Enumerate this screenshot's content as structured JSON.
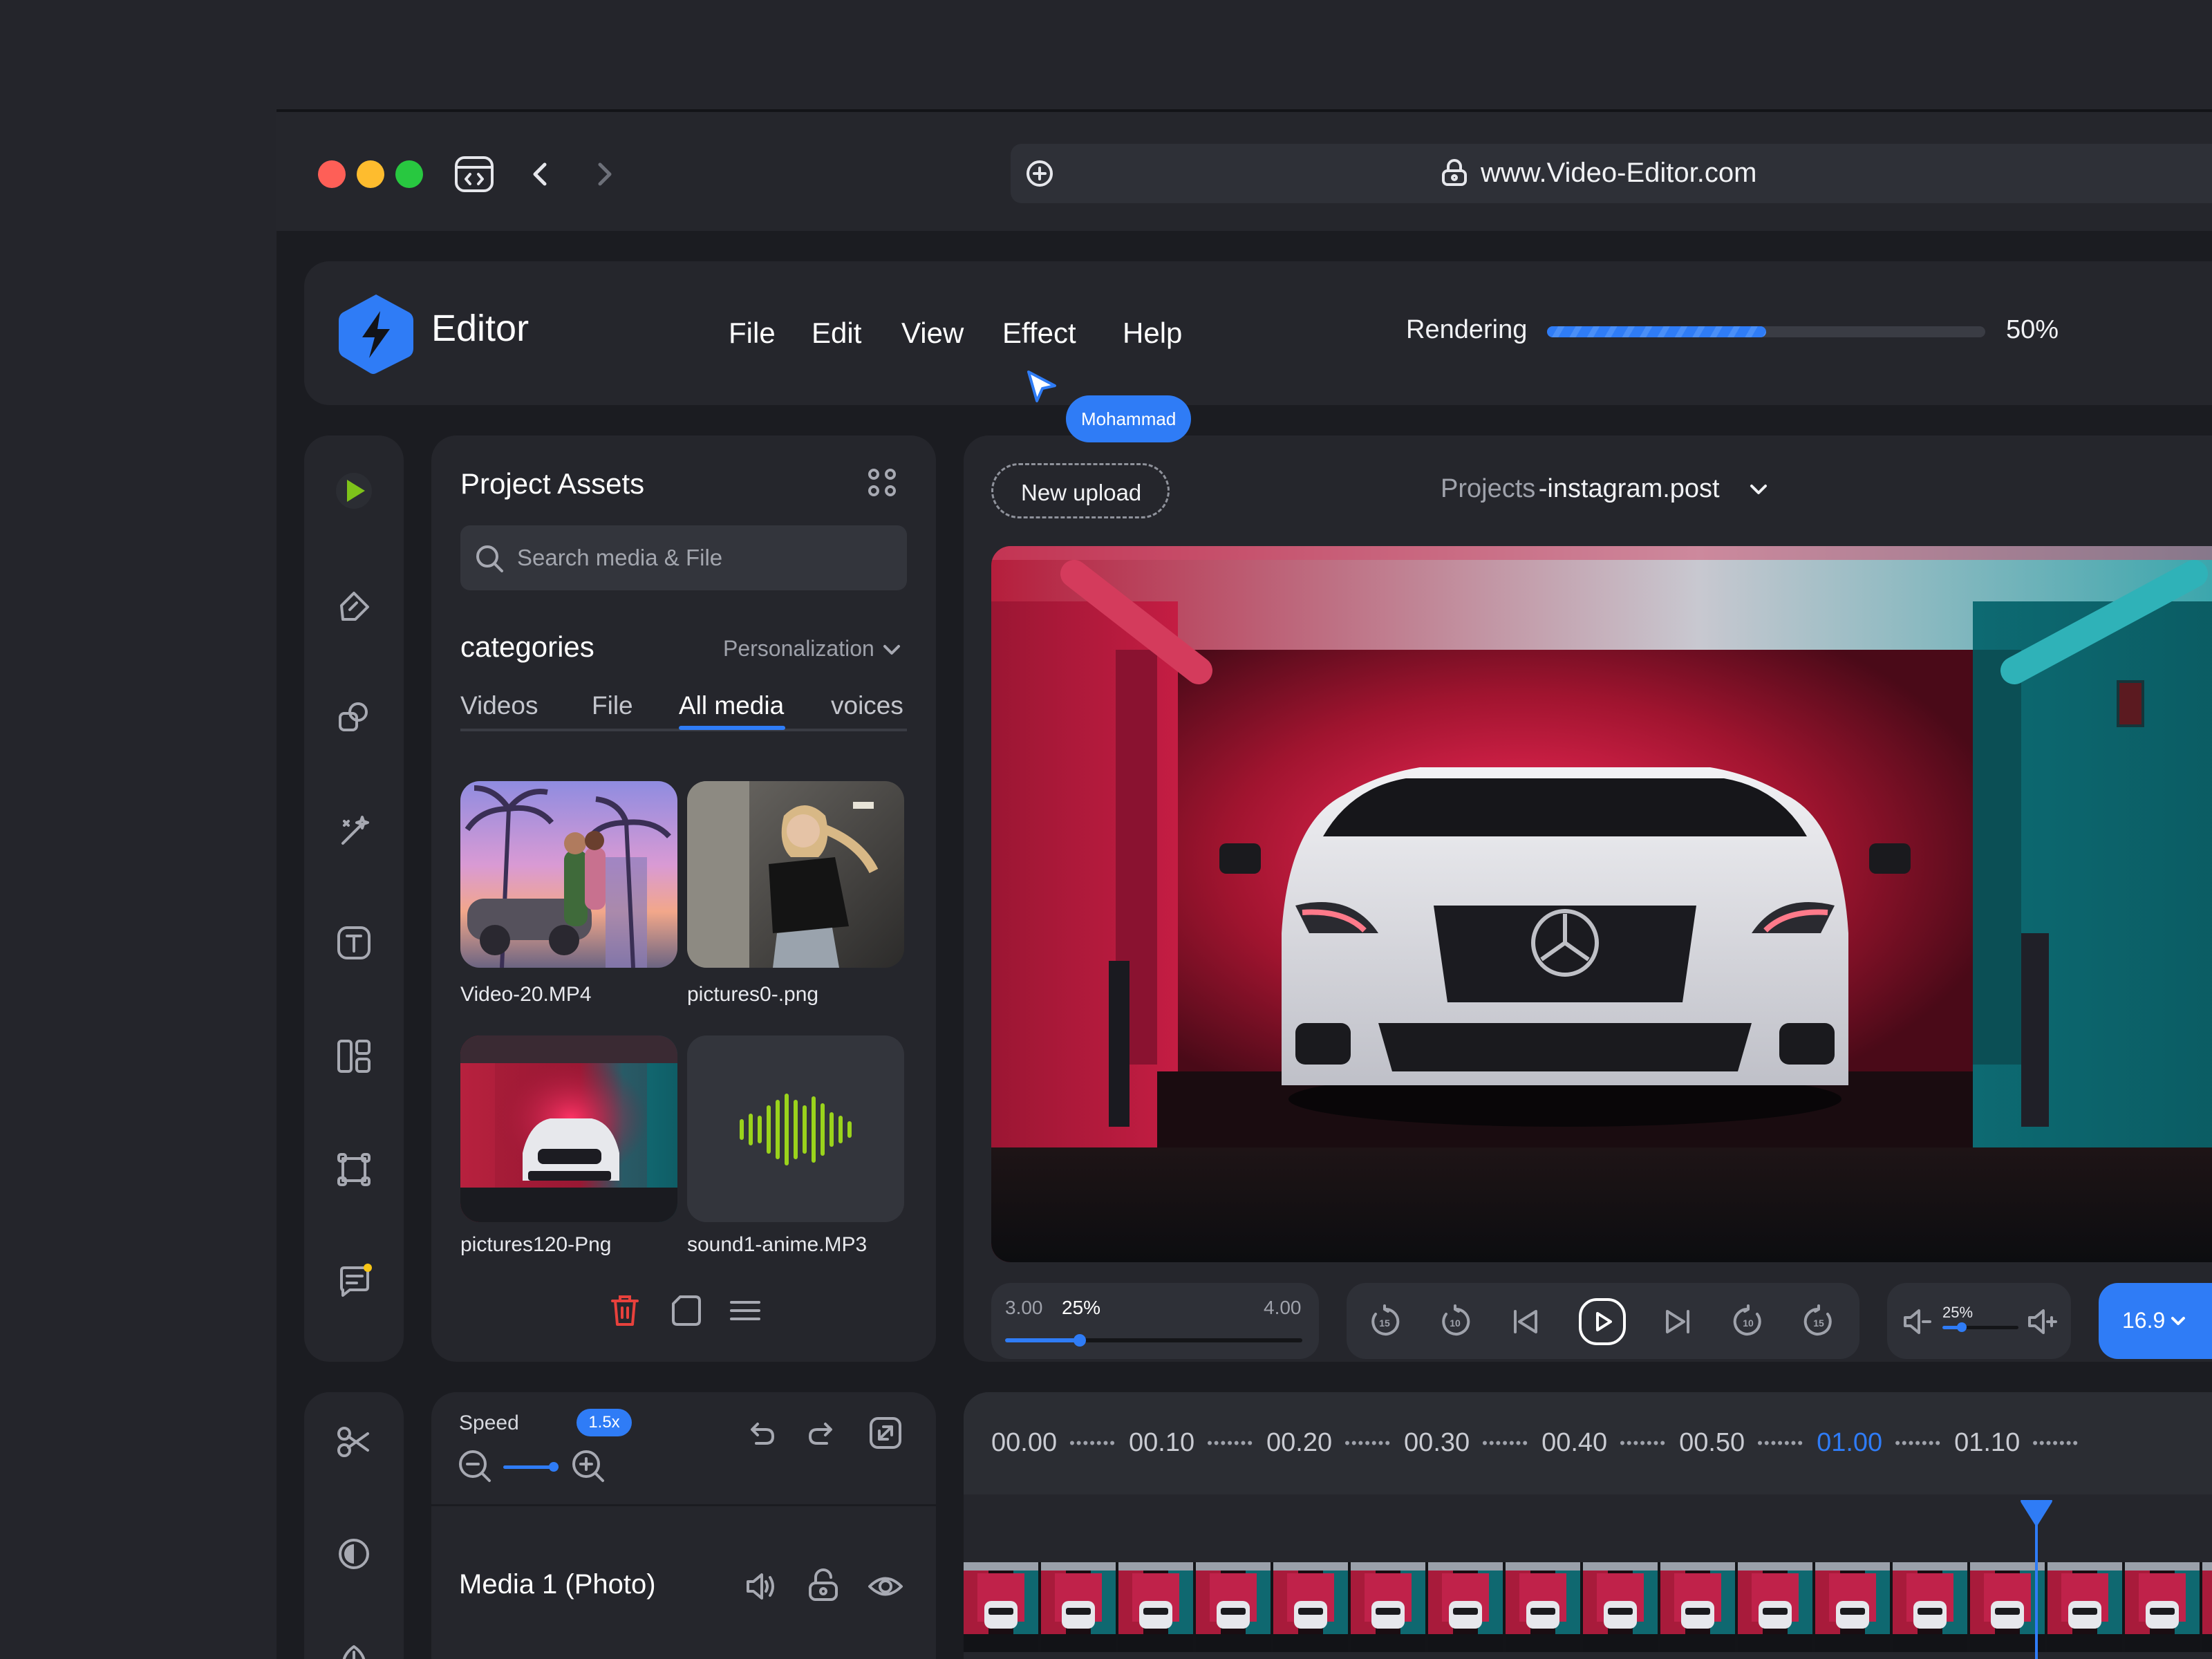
{
  "browser": {
    "url": "www.Video-Editor.com"
  },
  "header": {
    "app_name": "Editor",
    "menu": [
      "File",
      "Edit",
      "View",
      "Effect",
      "Help"
    ],
    "rendering_label": "Rendering",
    "rendering_percent": "50%",
    "rendering_progress": 0.5,
    "cursor_user": "Mohammad"
  },
  "assets": {
    "title": "Project Assets",
    "search_placeholder": "Search media & File",
    "categories_label": "categories",
    "personalization": "Personalization",
    "tabs": [
      "Videos",
      "File",
      "All media",
      "voices"
    ],
    "active_tab": "All media",
    "items": [
      {
        "name": "Video-20.MP4"
      },
      {
        "name": "pictures0-.png"
      },
      {
        "name": "pictures120-Png"
      },
      {
        "name": "sound1-anime.MP3"
      }
    ]
  },
  "preview": {
    "new_upload": "New upload",
    "project_prefix": "Projects",
    "project_name": "-instagram.post",
    "scrub_start": "3.00",
    "scrub_percent": "25%",
    "scrub_end": "4.00",
    "scrub_value": 0.25,
    "volume_percent": "25%",
    "volume_value": 0.25,
    "aspect_ratio": "16.9"
  },
  "timeline_controls": {
    "speed_label": "Speed",
    "speed_value": "1.5x",
    "track_name": "Media 1 (Photo)"
  },
  "timeline": {
    "ticks": [
      "00.00",
      "00.10",
      "00.20",
      "00.30",
      "00.40",
      "00.50",
      "01.00",
      "01.10"
    ],
    "active_tick": "01.00"
  },
  "colors": {
    "accent": "#2f7cf6",
    "danger": "#e8413c",
    "waveform": "#9ad31c",
    "traffic_red": "#fe5f57",
    "traffic_yellow": "#febc2e",
    "traffic_green": "#28c840"
  }
}
